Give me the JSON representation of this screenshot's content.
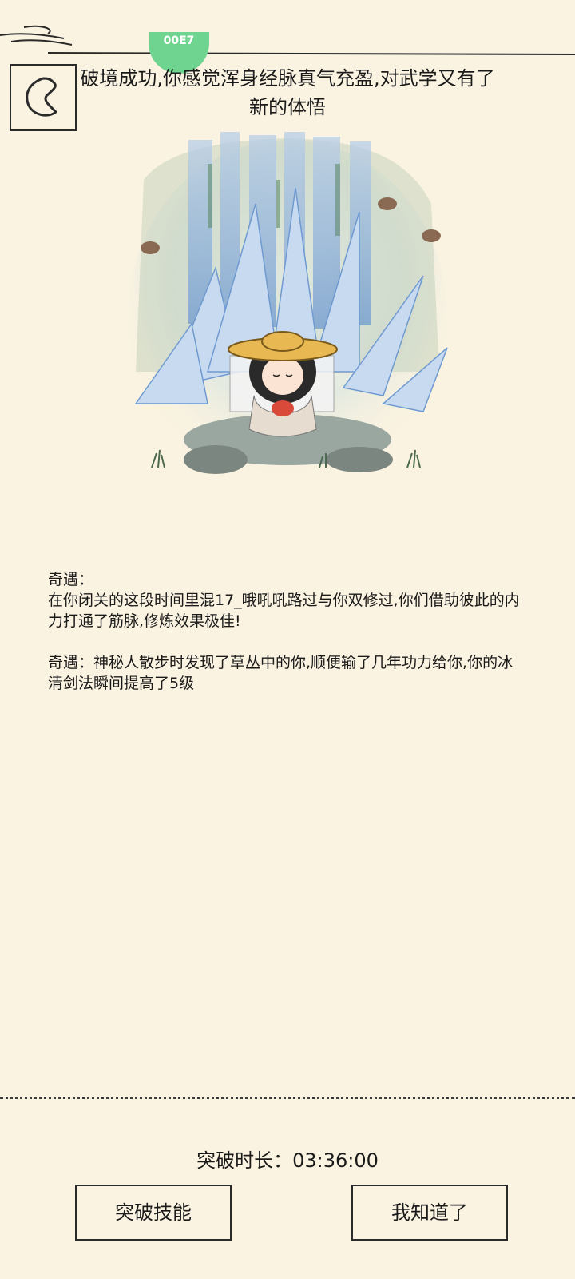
{
  "status": {
    "badge_text": "00E7"
  },
  "header": {
    "back_icon": "back-arrow-icon",
    "title": "破境成功,你感觉浑身经脉真气充盈,对武学又有了新的体悟"
  },
  "illustration": {
    "subject": "meditating-hero-under-waterfall"
  },
  "events": [
    {
      "title": "奇遇：",
      "text": "在你闭关的这段时间里混17_哦吼吼路过与你双修过,你们借助彼此的内力打通了筋脉,修炼效果极佳!"
    },
    {
      "title": "奇遇：",
      "text": "神秘人散步时发现了草丛中的你,顺便输了几年功力给你,你的冰清剑法瞬间提高了5级"
    }
  ],
  "footer": {
    "duration_label": "突破时长：",
    "duration_value": "03:36:00",
    "left_button": "突破技能",
    "right_button": "我知道了"
  },
  "colors": {
    "background": "#fbf3e1",
    "ink": "#1a1a1a",
    "badge": "#6fd48f",
    "water": "#8fb3dc"
  }
}
